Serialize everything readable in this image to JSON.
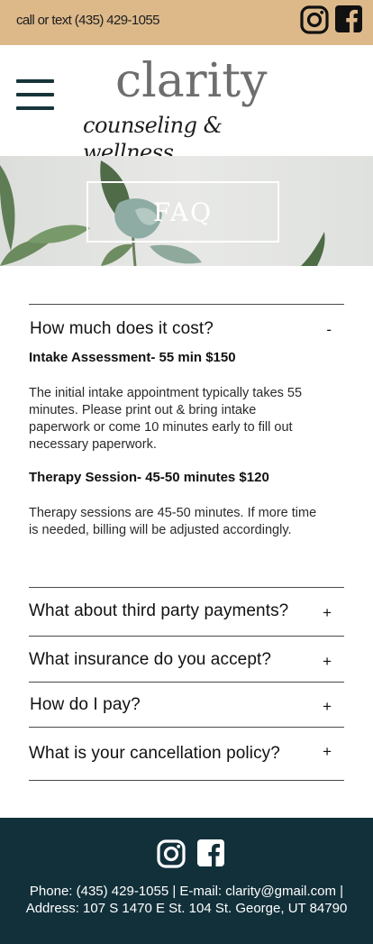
{
  "topbar": {
    "contact_text": "call or text (435) 429-1055",
    "icons": [
      "instagram-icon",
      "facebook-icon"
    ],
    "background_color": "#ddb98a"
  },
  "header": {
    "logo_main": "clarity",
    "logo_sub": "counseling & wellness",
    "menu_icon": "hamburger-menu-icon"
  },
  "hero": {
    "title": "FAQ"
  },
  "faq": {
    "items": [
      {
        "question": "How much does it cost?",
        "toggle": "-",
        "expanded": true,
        "sections": [
          {
            "heading": "Intake Assessment- 55 min $150",
            "text": "The initial intake appointment typically takes 55 minutes. Please print out & bring intake paperwork or come 10 minutes early to fill out necessary paperwork."
          },
          {
            "heading": "Therapy Session- 45-50 minutes $120",
            "text": "Therapy sessions are 45-50 minutes. If more time is needed, billing will be adjusted accordingly."
          }
        ]
      },
      {
        "question": "What about third party payments?",
        "toggle": "+",
        "expanded": false
      },
      {
        "question": "What insurance do you accept?",
        "toggle": "+",
        "expanded": false
      },
      {
        "question": "How do I pay?",
        "toggle": "+",
        "expanded": false
      },
      {
        "question": "What is your cancellation policy?",
        "toggle": "+",
        "expanded": false
      }
    ]
  },
  "footer": {
    "icons": [
      "instagram-icon",
      "facebook-icon"
    ],
    "line1": "Phone: (435) 429-1055 | E-mail: clarity@gmail.com |",
    "line2": "Address: 107 S 1470 E St. 104 St. George, UT 84790",
    "background_color": "#12303a"
  }
}
